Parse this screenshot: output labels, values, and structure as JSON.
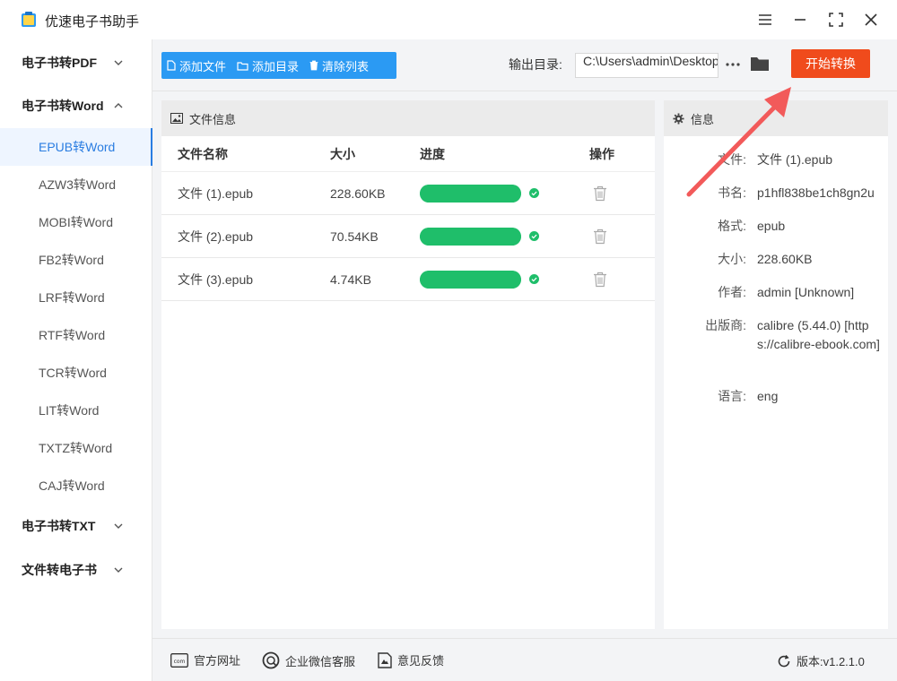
{
  "window": {
    "title": "优速电子书助手"
  },
  "sidebar": {
    "groups": [
      {
        "label": "电子书转PDF"
      },
      {
        "label": "电子书转Word"
      },
      {
        "label": "电子书转TXT"
      },
      {
        "label": "文件转电子书"
      }
    ],
    "word_items": [
      {
        "label": "EPUB转Word"
      },
      {
        "label": "AZW3转Word"
      },
      {
        "label": "MOBI转Word"
      },
      {
        "label": "FB2转Word"
      },
      {
        "label": "LRF转Word"
      },
      {
        "label": "RTF转Word"
      },
      {
        "label": "TCR转Word"
      },
      {
        "label": "LIT转Word"
      },
      {
        "label": "TXTZ转Word"
      },
      {
        "label": "CAJ转Word"
      }
    ]
  },
  "toolbar": {
    "add_file": "添加文件",
    "add_dir": "添加目录",
    "clear_list": "清除列表",
    "output_label": "输出目录:",
    "output_value": "C:\\Users\\admin\\Desktop",
    "start": "开始转换"
  },
  "file_panel": {
    "title": "文件信息",
    "columns": {
      "name": "文件名称",
      "size": "大小",
      "progress": "进度",
      "action": "操作"
    },
    "rows": [
      {
        "name": "文件 (1).epub",
        "size": "228.60KB",
        "progress": 1.0
      },
      {
        "name": "文件 (2).epub",
        "size": "70.54KB",
        "progress": 1.0
      },
      {
        "name": "文件 (3).epub",
        "size": "4.74KB",
        "progress": 1.0
      }
    ]
  },
  "info_panel": {
    "title": "信息",
    "fields": [
      {
        "key": "文件:",
        "value": "文件 (1).epub"
      },
      {
        "key": "书名:",
        "value": "p1hfl838be1ch8gn2u"
      },
      {
        "key": "格式:",
        "value": "epub"
      },
      {
        "key": "大小:",
        "value": "228.60KB"
      },
      {
        "key": "作者:",
        "value": "admin [Unknown]"
      },
      {
        "key": "出版商:",
        "value": "calibre (5.44.0) [https://calibre-ebook.com]"
      },
      {
        "key": "语言:",
        "value": "eng"
      }
    ]
  },
  "footer": {
    "website": "官方网址",
    "wechat": "企业微信客服",
    "feedback": "意见反馈",
    "version": "版本:v1.2.1.0"
  },
  "colors": {
    "primary": "#2b9af3",
    "start_button": "#f04b1c",
    "progress": "#1fbe6a",
    "active_nav": "#2a7de1"
  }
}
